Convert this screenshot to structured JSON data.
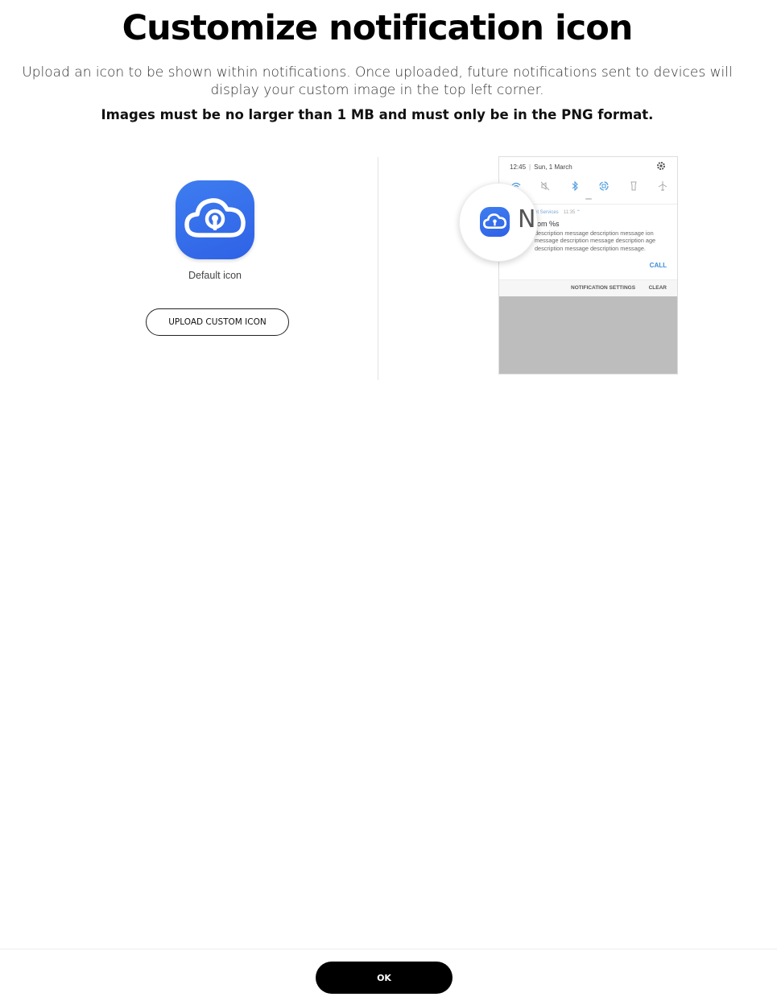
{
  "header": {
    "title": "Customize notification icon",
    "description": "Upload an icon to be shown within notifications. Once uploaded, future notifications sent to devices will display your custom image in the top left corner.",
    "requirement": "Images must be no larger than 1 MB and must only be in the PNG format."
  },
  "left_panel": {
    "default_icon_label": "Default icon",
    "upload_button_label": "UPLOAD CUSTOM ICON",
    "icon_color": "#2f62e6"
  },
  "preview": {
    "time": "12:45",
    "date": "Sun, 1 March",
    "app_name": "et Services",
    "app_time": "11:35",
    "notif_title": "rom %s",
    "notif_body": "description message description message ion message description message description age description message description message.",
    "call_label": "CALL",
    "settings_label": "NOTIFICATION SETTINGS",
    "clear_label": "CLEAR",
    "magnified_letter": "N",
    "accent_color": "#3c8ed6"
  },
  "footer": {
    "ok_label": "OK"
  }
}
